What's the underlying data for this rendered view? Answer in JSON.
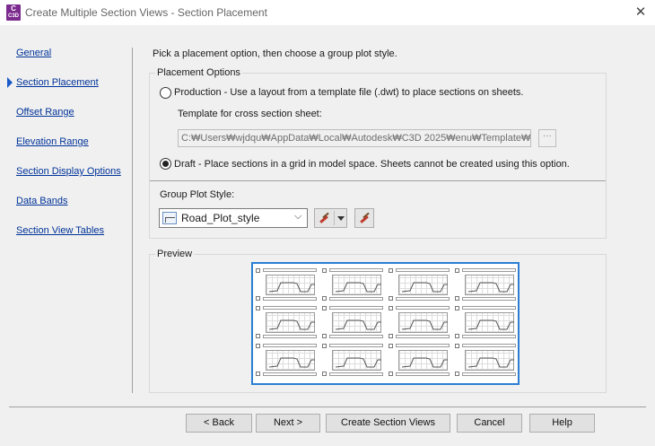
{
  "window": {
    "title": "Create Multiple Section Views - Section Placement",
    "icon_top": "C",
    "icon_bottom": "C3D",
    "close_glyph": "✕"
  },
  "sidebar": {
    "items": [
      {
        "label": "General"
      },
      {
        "label": "Section Placement"
      },
      {
        "label": "Offset Range"
      },
      {
        "label": "Elevation Range"
      },
      {
        "label": "Section Display Options"
      },
      {
        "label": "Data Bands"
      },
      {
        "label": "Section View Tables"
      }
    ],
    "active_index": 1
  },
  "instruction": "Pick a placement option, then choose a group plot style.",
  "placement": {
    "group_label": "Placement Options",
    "production_label": "Production - Use a layout from a template file (.dwt) to place sections on sheets.",
    "template_label": "Template for cross section sheet:",
    "template_path": "C:₩Users₩wjdqu₩AppData₩Local₩Autodesk₩C3D 2025₩enu₩Template₩",
    "browse_glyph": "···",
    "draft_label": "Draft - Place sections in a grid in model space. Sheets cannot be created using this option.",
    "selected": "draft"
  },
  "plot_style": {
    "label": "Group Plot Style:",
    "value": "Road_Plot_style",
    "chevron": "⌵",
    "edit_icon": "brush-icon",
    "pick_icon": "brush-magnifier-icon"
  },
  "preview": {
    "label": "Preview",
    "rows": 3,
    "cols": 4
  },
  "buttons": {
    "back": "< Back",
    "next": "Next >",
    "create": "Create Section Views",
    "cancel": "Cancel",
    "help": "Help"
  },
  "colors": {
    "accent": "#2a7fd4",
    "link": "#003399",
    "app_icon": "#7b2a8e"
  }
}
